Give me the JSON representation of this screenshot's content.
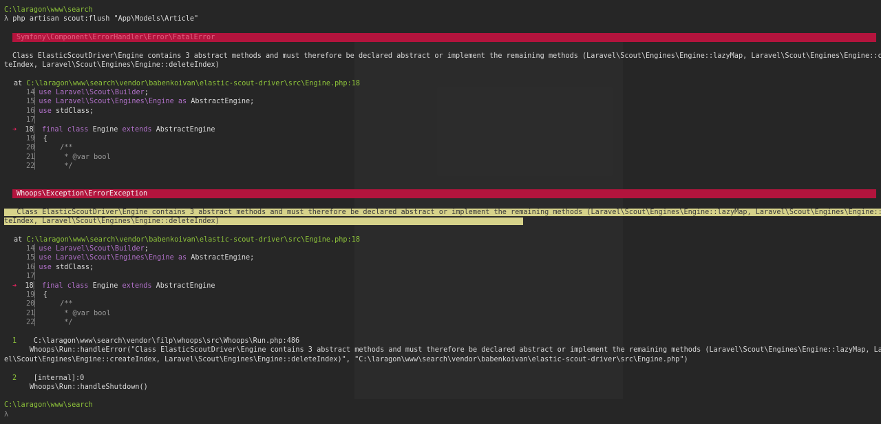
{
  "prompt_path_1": "C:\\laragon\\www\\search",
  "command_symbol": "λ",
  "command": "php artisan scout:flush \"App\\Models\\Article\"",
  "error1": {
    "title": "Symfony\\Component\\ErrorHandler\\Error\\FatalError",
    "message_1": "Class ElasticScoutDriver\\Engine contains 3 abstract methods and must therefore be declared abstract or implement the remaining methods (Laravel\\Scout\\Engines\\Engine::lazyMap, Laravel\\Scout\\Engines\\Engine::crea",
    "message_2": "teIndex, Laravel\\Scout\\Engines\\Engine::deleteIndex)",
    "at_label": "at",
    "at_path": "C:\\laragon\\www\\search\\vendor\\babenkoivan\\elastic-scout-driver\\src\\Engine.php:18"
  },
  "code": [
    {
      "n": "14",
      "kw": "use",
      "rest": " ",
      "ns": "Laravel\\Scout\\Builder",
      "tail": ";"
    },
    {
      "n": "15",
      "kw": "use",
      "rest": " ",
      "ns": "Laravel\\Scout\\Engines\\Engine",
      "as": " as ",
      "alias": "AbstractEngine",
      "tail": ";"
    },
    {
      "n": "16",
      "kw": "use",
      "rest": " stdClass;"
    },
    {
      "n": "17"
    },
    {
      "n": "18",
      "arrow": "➜",
      "kw1": "final",
      "kw2": "class",
      "name": " Engine ",
      "kw3": "extends",
      "parent": " AbstractEngine"
    },
    {
      "n": "19",
      "text": "{"
    },
    {
      "n": "20",
      "text": "    /**"
    },
    {
      "n": "21",
      "text": "     * @var bool"
    },
    {
      "n": "22",
      "text": "     */"
    }
  ],
  "error2": {
    "title": "Whoops\\Exception\\ErrorException",
    "message_1": "Class ElasticScoutDriver\\Engine contains 3 abstract methods and must therefore be declared abstract or implement the remaining methods (Laravel\\Scout\\Engines\\Engine::lazyMap, Laravel\\Scout\\Engines\\Engine::crea",
    "message_2": "teIndex, Laravel\\Scout\\Engines\\Engine::deleteIndex)",
    "at_label": "at",
    "at_path": "C:\\laragon\\www\\search\\vendor\\babenkoivan\\elastic-scout-driver\\src\\Engine.php:18"
  },
  "trace": [
    {
      "index": "1",
      "file": "C:\\laragon\\www\\search\\vendor\\filp\\whoops\\src\\Whoops\\Run.php:486",
      "call_1": "Whoops\\Run::handleError(\"Class ElasticScoutDriver\\Engine contains 3 abstract methods and must therefore be declared abstract or implement the remaining methods (Laravel\\Scout\\Engines\\Engine::lazyMap, Larav",
      "call_2": "el\\Scout\\Engines\\Engine::createIndex, Laravel\\Scout\\Engines\\Engine::deleteIndex)\", \"C:\\laragon\\www\\search\\vendor\\babenkoivan\\elastic-scout-driver\\src\\Engine.php\")"
    },
    {
      "index": "2",
      "file": "[internal]:0",
      "call_1": "Whoops\\Run::handleShutdown()"
    }
  ],
  "prompt_path_2": "C:\\laragon\\www\\search",
  "prompt_symbol_2": "λ",
  "colors": {
    "background": "#262626",
    "error_bar": "#b3143d",
    "highlight": "#d6d28a",
    "path_green": "#8ec43a",
    "keyword_purple": "#b070c8",
    "arrow_red": "#e0245e"
  }
}
